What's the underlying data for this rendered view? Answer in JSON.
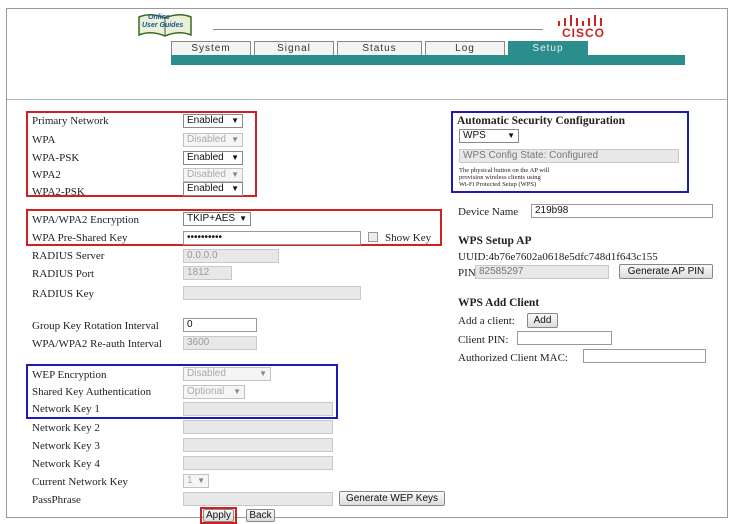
{
  "header": {
    "logo_line1": "Online",
    "logo_line2": "User Guides",
    "cisco_text": "CISCO"
  },
  "tabs": [
    {
      "label": "System"
    },
    {
      "label": "Signal"
    },
    {
      "label": "Status"
    },
    {
      "label": "Log"
    },
    {
      "label": "Setup"
    }
  ],
  "left": {
    "primary_network": {
      "label": "Primary Network",
      "value": "Enabled"
    },
    "wpa": {
      "label": "WPA",
      "value": "Disabled"
    },
    "wpa_psk": {
      "label": "WPA-PSK",
      "value": "Enabled"
    },
    "wpa2": {
      "label": "WPA2",
      "value": "Disabled"
    },
    "wpa2_psk": {
      "label": "WPA2-PSK",
      "value": "Enabled"
    },
    "encryption": {
      "label": "WPA/WPA2 Encryption",
      "value": "TKIP+AES"
    },
    "psk": {
      "label": "WPA Pre-Shared Key",
      "value": "••••••••••",
      "show_key": "Show Key"
    },
    "radius_server": {
      "label": "RADIUS Server",
      "value": "0.0.0.0"
    },
    "radius_port": {
      "label": "RADIUS Port",
      "value": "1812"
    },
    "radius_key": {
      "label": "RADIUS Key",
      "value": ""
    },
    "group_key": {
      "label": "Group Key Rotation Interval",
      "value": "0"
    },
    "reauth": {
      "label": "WPA/WPA2 Re-auth Interval",
      "value": "3600"
    },
    "wep": {
      "label": "WEP Encryption",
      "value": "Disabled"
    },
    "shared_key": {
      "label": "Shared Key Authentication",
      "value": "Optional"
    },
    "netkey1": {
      "label": "Network Key 1"
    },
    "netkey2": {
      "label": "Network Key 2"
    },
    "netkey3": {
      "label": "Network Key 3"
    },
    "netkey4": {
      "label": "Network Key 4"
    },
    "current_key": {
      "label": "Current Network Key",
      "value": "1"
    },
    "passphrase": {
      "label": "PassPhrase",
      "generate": "Generate WEP Keys"
    },
    "apply": "Apply",
    "back": "Back"
  },
  "right": {
    "auto_sec": {
      "title": "Automatic Security Configuration",
      "select": "WPS",
      "state": "WPS Config State: Configured",
      "note1": "The physical button on the AP will",
      "note2": "provision wireless clients using",
      "note3": "Wi-Fi Protected Setup (WPS)"
    },
    "device_name": {
      "label": "Device Name",
      "value": "219b98"
    },
    "wps_ap": {
      "title": "WPS Setup AP",
      "uuid": "UUID:4b76e7602a0618e5dfc748d1f643c155",
      "pin_label": "PIN:",
      "pin_value": "82585297",
      "generate": "Generate AP PIN"
    },
    "wps_client": {
      "title": "WPS Add Client",
      "add_label": "Add a client:",
      "add_button": "Add",
      "client_pin": "Client PIN:",
      "auth_mac": "Authorized Client MAC:"
    }
  }
}
